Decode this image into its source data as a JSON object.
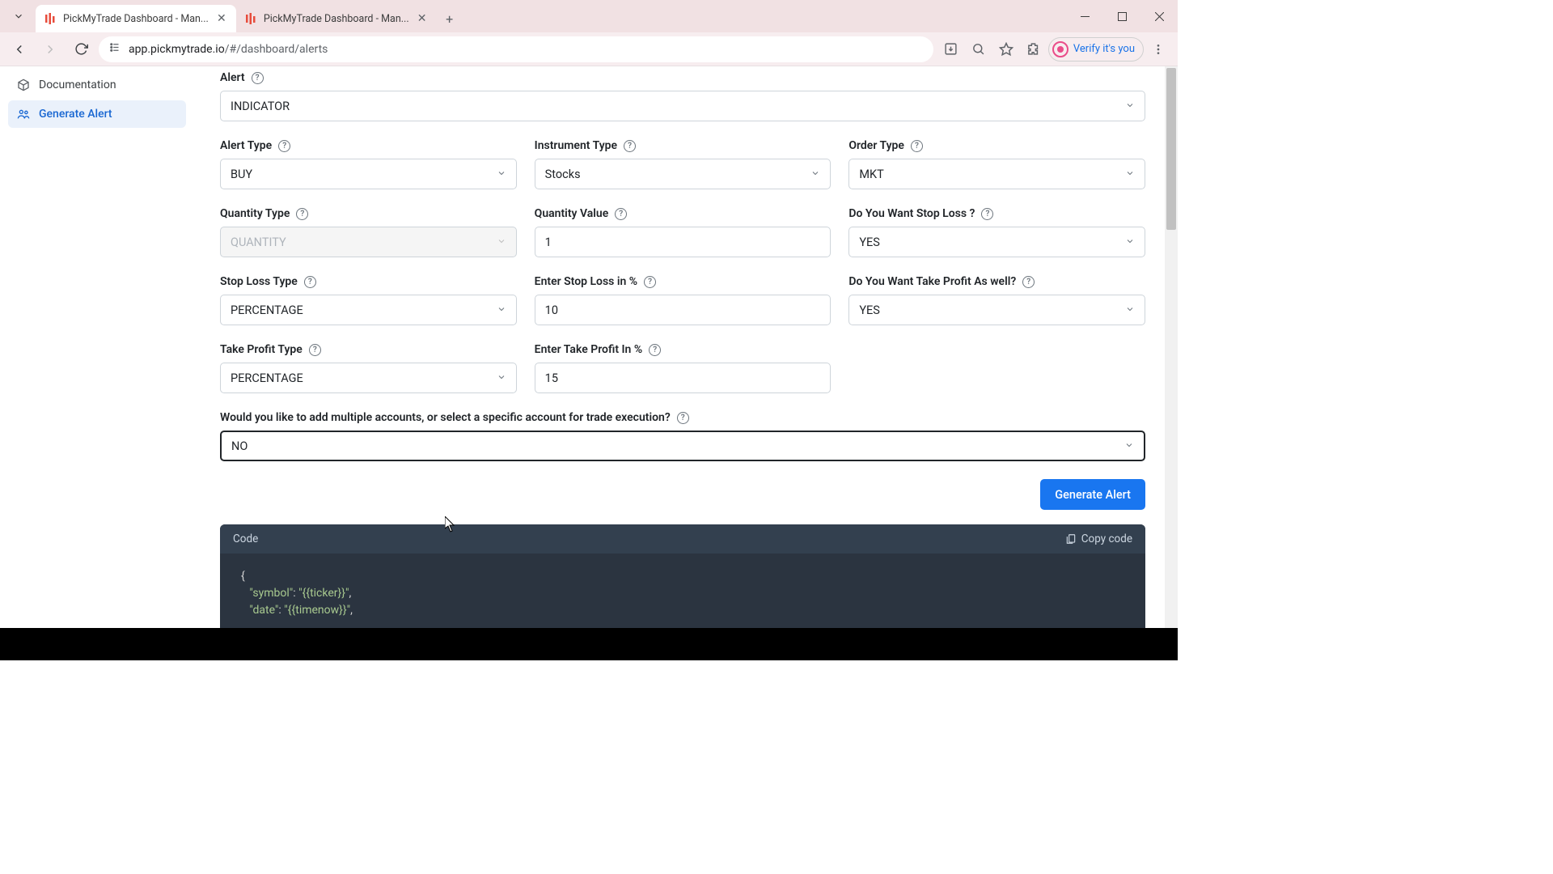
{
  "browser": {
    "tabs": [
      {
        "title": "PickMyTrade Dashboard - Man..."
      },
      {
        "title": "PickMyTrade Dashboard - Man..."
      }
    ],
    "url_host": "app.pickmytrade.io",
    "url_path": "/#/dashboard/alerts",
    "verify": "Verify it's you"
  },
  "sidebar": {
    "documentation": "Documentation",
    "generate_alert": "Generate Alert"
  },
  "form": {
    "alert": {
      "label": "Alert",
      "value": "INDICATOR"
    },
    "alert_type": {
      "label": "Alert Type",
      "value": "BUY"
    },
    "instrument_type": {
      "label": "Instrument Type",
      "value": "Stocks"
    },
    "order_type": {
      "label": "Order Type",
      "value": "MKT"
    },
    "quantity_type": {
      "label": "Quantity Type",
      "value": "QUANTITY"
    },
    "quantity_value": {
      "label": "Quantity Value",
      "value": "1"
    },
    "want_stop_loss": {
      "label": "Do You Want Stop Loss ?",
      "value": "YES"
    },
    "stop_loss_type": {
      "label": "Stop Loss Type",
      "value": "PERCENTAGE"
    },
    "enter_stop_loss": {
      "label": "Enter Stop Loss in %",
      "value": "10"
    },
    "want_take_profit": {
      "label": "Do You Want Take Profit As well?",
      "value": "YES"
    },
    "take_profit_type": {
      "label": "Take Profit Type",
      "value": "PERCENTAGE"
    },
    "enter_take_profit": {
      "label": "Enter Take Profit In %",
      "value": "15"
    },
    "multiple_accounts": {
      "label": "Would you like to add multiple accounts, or select a specific account for trade execution?",
      "value": "NO"
    },
    "generate_button": "Generate Alert"
  },
  "code": {
    "title": "Code",
    "copy": "Copy code",
    "line1_open": "{",
    "line2_key": "\"symbol\"",
    "line2_colon": ": ",
    "line2_val": "\"{{ticker}}\"",
    "line2_comma": ",",
    "line3_key": "\"date\"",
    "line3_colon": ": ",
    "line3_val": "\"{{timenow}}\"",
    "line3_comma": ","
  }
}
